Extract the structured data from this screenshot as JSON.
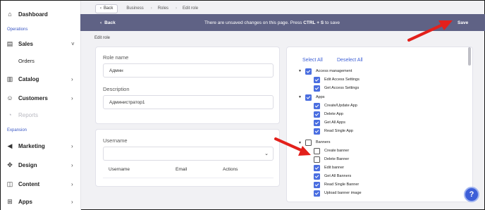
{
  "sidebar": {
    "items": [
      {
        "label": "Dashboard",
        "icon": "home-icon"
      },
      {
        "section": "Operations"
      },
      {
        "label": "Sales",
        "icon": "document-icon",
        "chevron": "˅"
      },
      {
        "label": "Orders",
        "sub": true
      },
      {
        "label": "Catalog",
        "icon": "book-icon",
        "chevron": "›"
      },
      {
        "label": "Customers",
        "icon": "users-icon",
        "chevron": "›"
      },
      {
        "label": "Reports",
        "icon": "chart-icon",
        "disabled": true
      },
      {
        "section": "Expansion"
      },
      {
        "label": "Marketing",
        "icon": "megaphone-icon",
        "chevron": "›"
      },
      {
        "label": "Design",
        "icon": "move-icon",
        "chevron": "›"
      },
      {
        "label": "Content",
        "icon": "layers-icon",
        "chevron": "›"
      },
      {
        "label": "Apps",
        "icon": "grid-icon",
        "chevron": "›"
      }
    ],
    "section_operations": "Operations",
    "section_expansion": "Expansion",
    "accent": "#3a57c4"
  },
  "breadcrumb": {
    "back_label": "Back",
    "items": [
      "Business",
      "Roles",
      "Edit role"
    ]
  },
  "banner": {
    "back_label": "Back",
    "message_pre": "There are unsaved changes on this page. Press ",
    "shortcut": "CTRL + S",
    "message_post": " to save",
    "save_label": "Save",
    "color": "#5f6285"
  },
  "page": {
    "section_title": "Edit role"
  },
  "role_form": {
    "name_label": "Role name",
    "name_value": "Адмнн",
    "description_label": "Description",
    "description_value": "Администратор1"
  },
  "users": {
    "username_label": "Username",
    "username_value": "",
    "columns": [
      "Username",
      "Email",
      "Actions"
    ]
  },
  "permissions": {
    "select_all": "Select All",
    "deselect_all": "Deselect All",
    "groups": [
      {
        "name": "Access management",
        "checked": true,
        "items": [
          {
            "name": "Edit Access Settings",
            "checked": true
          },
          {
            "name": "Get Access Settings",
            "checked": true
          }
        ]
      },
      {
        "name": "Apps",
        "checked": true,
        "items": [
          {
            "name": "Create/Update App",
            "checked": true
          },
          {
            "name": "Delete App",
            "checked": true
          },
          {
            "name": "Get All Apps",
            "checked": true
          },
          {
            "name": "Read Single App",
            "checked": true
          }
        ]
      },
      {
        "name": "Banners",
        "checked": false,
        "items": [
          {
            "name": "Create banner",
            "checked": false
          },
          {
            "name": "Delete Banner",
            "checked": false
          },
          {
            "name": "Edit banner",
            "checked": true
          },
          {
            "name": "Get All Banners",
            "checked": true
          },
          {
            "name": "Read Single Banner",
            "checked": true
          },
          {
            "name": "Upload banner image",
            "checked": true
          }
        ]
      }
    ],
    "accent": "#4a6ee0"
  },
  "help_label": "?"
}
